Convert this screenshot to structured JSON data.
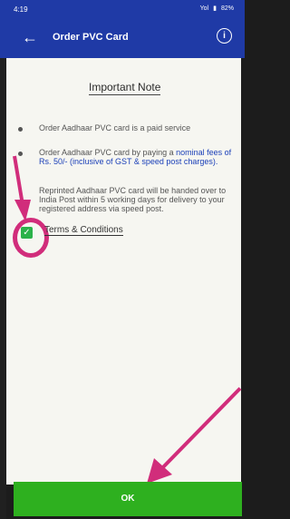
{
  "status_bar": {
    "time": "4:19",
    "signal": "Yol",
    "battery": "82%"
  },
  "app_bar": {
    "back_icon": "arrow-left-icon",
    "title": "Order PVC Card",
    "info_icon": "info-icon"
  },
  "content": {
    "heading": "Important Note",
    "bullets": [
      {
        "text": "Order Aadhaar PVC card is a paid service"
      },
      {
        "text_before": "Order Aadhaar PVC card by paying a ",
        "highlight": "nominal fees of Rs. 50/- (inclusive of GST & speed post charges)."
      },
      {
        "text": "Reprinted Aadhaar PVC card will be handed over to India Post within 5 working days for delivery to your registered address via speed post."
      }
    ],
    "terms_label": "Terms & Conditions",
    "checkbox_checked": true
  },
  "ok_label": "OK",
  "colors": {
    "app_bar": "#1f3aa6",
    "ok_bar": "#2eb01f",
    "annotation": "#d12d7b",
    "link": "#1a3fb8"
  }
}
